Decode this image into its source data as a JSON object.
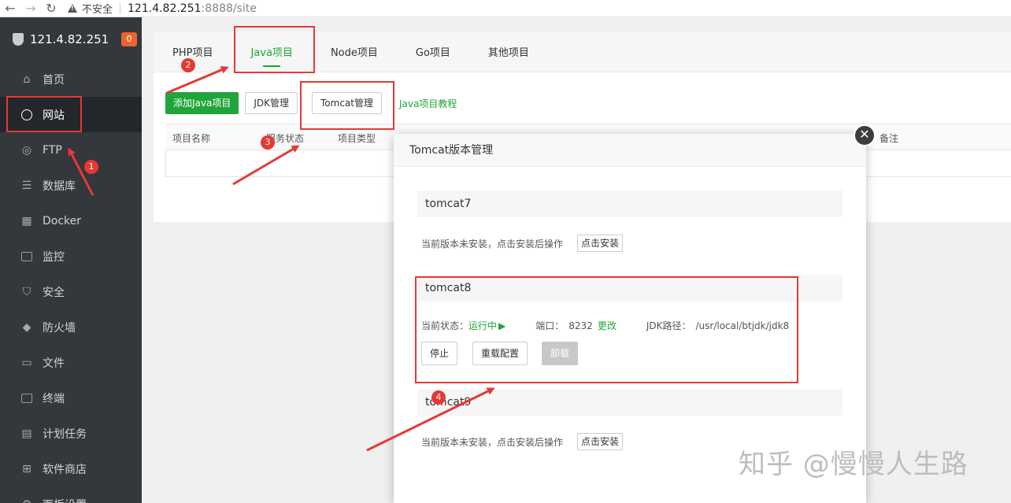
{
  "browser": {
    "insecure_label": "不安全",
    "url_host": "121.4.82.251",
    "url_rest": ":8888/site"
  },
  "sidebar": {
    "server": "121.4.82.251",
    "badge": "0",
    "items": [
      {
        "label": "首页",
        "icon": "home-icon"
      },
      {
        "label": "网站",
        "icon": "globe-icon"
      },
      {
        "label": "FTP",
        "icon": "ftp-icon"
      },
      {
        "label": "数据库",
        "icon": "database-icon"
      },
      {
        "label": "Docker",
        "icon": "docker-icon"
      },
      {
        "label": "监控",
        "icon": "monitor-icon"
      },
      {
        "label": "安全",
        "icon": "shield-icon"
      },
      {
        "label": "防火墙",
        "icon": "firewall-icon"
      },
      {
        "label": "文件",
        "icon": "folder-icon"
      },
      {
        "label": "终端",
        "icon": "terminal-icon"
      },
      {
        "label": "计划任务",
        "icon": "calendar-icon"
      },
      {
        "label": "软件商店",
        "icon": "apps-icon"
      },
      {
        "label": "面板设置",
        "icon": "settings-icon"
      }
    ]
  },
  "tabs": [
    "PHP项目",
    "Java项目",
    "Node项目",
    "Go项目",
    "其他项目"
  ],
  "toolbar": {
    "add": "添加Java项目",
    "jdk": "JDK管理",
    "tomcat": "Tomcat管理",
    "tutorial": "Java项目教程"
  },
  "table": {
    "headers": [
      "项目名称",
      "服务状态",
      "项目类型",
      "备注"
    ]
  },
  "modal": {
    "title": "Tomcat版本管理",
    "close": "✕",
    "not_installed_text": "当前版本未安装，点击安装后操作",
    "install_btn": "点击安装",
    "versions": {
      "t7": "tomcat7",
      "t8": "tomcat8",
      "t9": "tomcat9"
    },
    "t8_status_label": "当前状态：",
    "t8_status_value": "运行中",
    "t8_port_label": "端口：",
    "t8_port_value": "8232",
    "t8_port_change": "更改",
    "t8_jdk_label": "JDK路径：",
    "t8_jdk_value": "/usr/local/btjdk/jdk8",
    "stop": "停止",
    "reconfig": "重载配置",
    "uninstall": "卸载"
  },
  "annotations": [
    "1",
    "2",
    "3",
    "4"
  ],
  "colors": {
    "accent": "#20a53a",
    "annotation": "#e53935",
    "sidebar": "#34373c"
  },
  "watermark": "知乎 @慢慢人生路"
}
